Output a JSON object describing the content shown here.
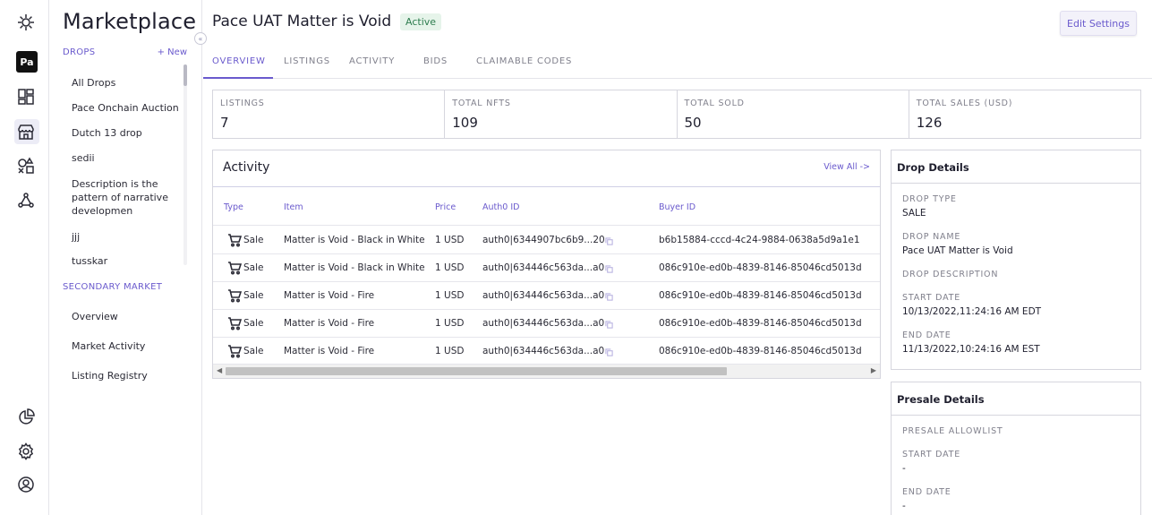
{
  "rail": {
    "workspace_badge": "Pa",
    "icons": [
      "logo-icon",
      "dashboard-icon",
      "marketplace-icon",
      "shapes-icon",
      "network-icon",
      "analytics-icon",
      "settings-icon",
      "account-icon"
    ]
  },
  "sidebar": {
    "title": "Marketplace",
    "drops_label": "DROPS",
    "new_label": "+ New",
    "drops": [
      "All Drops",
      "Pace Onchain Auction",
      "Dutch 13 drop",
      "sedii",
      "Description is the pattern of narrative developmen",
      "jjj",
      "tusskar"
    ],
    "secondary_label": "SECONDARY MARKET",
    "secondary": [
      "Overview",
      "Market Activity",
      "Listing Registry"
    ]
  },
  "header": {
    "title": "Pace UAT Matter is Void",
    "status": "Active",
    "edit_button": "Edit Settings"
  },
  "tabs": [
    "OVERVIEW",
    "LISTINGS",
    "ACTIVITY",
    "BIDS",
    "CLAIMABLE CODES"
  ],
  "stats": [
    {
      "label": "LISTINGS",
      "value": "7"
    },
    {
      "label": "TOTAL NFTS",
      "value": "109"
    },
    {
      "label": "TOTAL SOLD",
      "value": "50"
    },
    {
      "label": "TOTAL SALES (USD)",
      "value": "126"
    }
  ],
  "activity": {
    "title": "Activity",
    "view_all": "View All ->",
    "columns": [
      "Type",
      "Item",
      "Price",
      "Auth0 ID",
      "Buyer ID"
    ],
    "rows": [
      {
        "type": "Sale",
        "item": "Matter is Void - Black in White",
        "price": "1 USD",
        "auth0": "auth0|6344907bc6b9...20",
        "buyer": "b6b15884-cccd-4c24-9884-0638a5d9a1e1"
      },
      {
        "type": "Sale",
        "item": "Matter is Void - Black in White",
        "price": "1 USD",
        "auth0": "auth0|634446c563da...a0",
        "buyer": "086c910e-ed0b-4839-8146-85046cd5013d"
      },
      {
        "type": "Sale",
        "item": "Matter is Void - Fire",
        "price": "1 USD",
        "auth0": "auth0|634446c563da...a0",
        "buyer": "086c910e-ed0b-4839-8146-85046cd5013d"
      },
      {
        "type": "Sale",
        "item": "Matter is Void - Fire",
        "price": "1 USD",
        "auth0": "auth0|634446c563da...a0",
        "buyer": "086c910e-ed0b-4839-8146-85046cd5013d"
      },
      {
        "type": "Sale",
        "item": "Matter is Void - Fire",
        "price": "1 USD",
        "auth0": "auth0|634446c563da...a0",
        "buyer": "086c910e-ed0b-4839-8146-85046cd5013d"
      }
    ]
  },
  "drop_details": {
    "title": "Drop Details",
    "fields": [
      {
        "label": "DROP TYPE",
        "value": "SALE"
      },
      {
        "label": "DROP NAME",
        "value": "Pace UAT Matter is Void"
      },
      {
        "label": "DROP DESCRIPTION",
        "value": ""
      },
      {
        "label": "START DATE",
        "value": "10/13/2022,11:24:16 AM EDT"
      },
      {
        "label": "END DATE",
        "value": "11/13/2022,10:24:16 AM EST"
      }
    ]
  },
  "presale_details": {
    "title": "Presale Details",
    "fields": [
      {
        "label": "PRESALE ALLOWLIST",
        "value": ""
      },
      {
        "label": "START DATE",
        "value": "-"
      },
      {
        "label": "END DATE",
        "value": "-"
      }
    ]
  },
  "colors": {
    "accent": "#6a5acd",
    "status_bg": "#e6f4ea",
    "status_text": "#2e7d4f"
  }
}
